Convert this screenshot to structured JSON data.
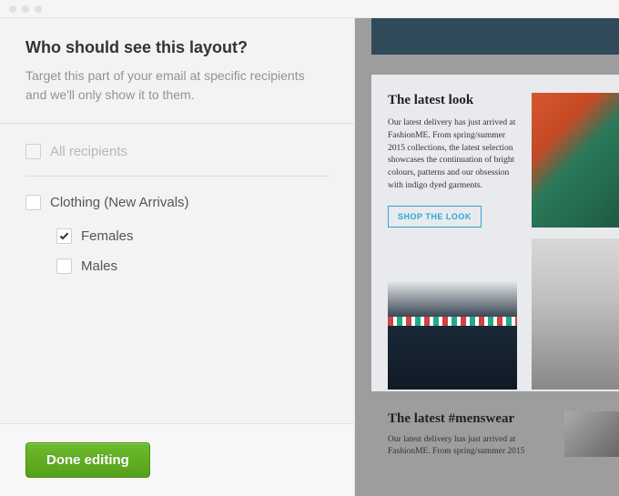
{
  "sidebar": {
    "title": "Who should see this layout?",
    "description": "Target this part of your email at specific recipients and we'll only show it to them.",
    "all_recipients_label": "All recipients",
    "group_label": "Clothing (New Arrivals)",
    "option_female": "Females",
    "option_male": "Males",
    "done_label": "Done editing"
  },
  "preview": {
    "card1": {
      "title": "The latest look",
      "body": "Our latest delivery has just arrived at FashionME. From spring/summer 2015 collections, the latest selection showcases the continuation of bright colours, patterns and our obsession with indigo dyed garments.",
      "cta": "SHOP THE LOOK"
    },
    "card2": {
      "title": "The latest #menswear",
      "body": "Our latest delivery has just arrived at FashionME. From spring/summer 2015"
    }
  }
}
